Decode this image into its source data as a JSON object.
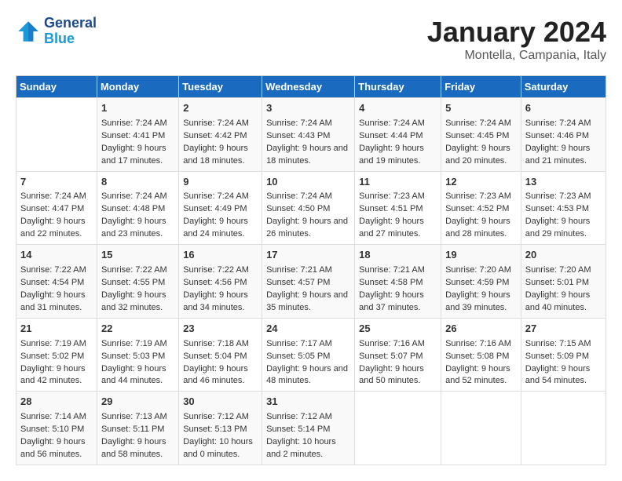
{
  "logo": {
    "line1": "General",
    "line2": "Blue"
  },
  "title": "January 2024",
  "location": "Montella, Campania, Italy",
  "days_of_week": [
    "Sunday",
    "Monday",
    "Tuesday",
    "Wednesday",
    "Thursday",
    "Friday",
    "Saturday"
  ],
  "weeks": [
    [
      {
        "day": "",
        "sunrise": "",
        "sunset": "",
        "daylight": ""
      },
      {
        "day": "1",
        "sunrise": "Sunrise: 7:24 AM",
        "sunset": "Sunset: 4:41 PM",
        "daylight": "Daylight: 9 hours and 17 minutes."
      },
      {
        "day": "2",
        "sunrise": "Sunrise: 7:24 AM",
        "sunset": "Sunset: 4:42 PM",
        "daylight": "Daylight: 9 hours and 18 minutes."
      },
      {
        "day": "3",
        "sunrise": "Sunrise: 7:24 AM",
        "sunset": "Sunset: 4:43 PM",
        "daylight": "Daylight: 9 hours and 18 minutes."
      },
      {
        "day": "4",
        "sunrise": "Sunrise: 7:24 AM",
        "sunset": "Sunset: 4:44 PM",
        "daylight": "Daylight: 9 hours and 19 minutes."
      },
      {
        "day": "5",
        "sunrise": "Sunrise: 7:24 AM",
        "sunset": "Sunset: 4:45 PM",
        "daylight": "Daylight: 9 hours and 20 minutes."
      },
      {
        "day": "6",
        "sunrise": "Sunrise: 7:24 AM",
        "sunset": "Sunset: 4:46 PM",
        "daylight": "Daylight: 9 hours and 21 minutes."
      }
    ],
    [
      {
        "day": "7",
        "sunrise": "Sunrise: 7:24 AM",
        "sunset": "Sunset: 4:47 PM",
        "daylight": "Daylight: 9 hours and 22 minutes."
      },
      {
        "day": "8",
        "sunrise": "Sunrise: 7:24 AM",
        "sunset": "Sunset: 4:48 PM",
        "daylight": "Daylight: 9 hours and 23 minutes."
      },
      {
        "day": "9",
        "sunrise": "Sunrise: 7:24 AM",
        "sunset": "Sunset: 4:49 PM",
        "daylight": "Daylight: 9 hours and 24 minutes."
      },
      {
        "day": "10",
        "sunrise": "Sunrise: 7:24 AM",
        "sunset": "Sunset: 4:50 PM",
        "daylight": "Daylight: 9 hours and 26 minutes."
      },
      {
        "day": "11",
        "sunrise": "Sunrise: 7:23 AM",
        "sunset": "Sunset: 4:51 PM",
        "daylight": "Daylight: 9 hours and 27 minutes."
      },
      {
        "day": "12",
        "sunrise": "Sunrise: 7:23 AM",
        "sunset": "Sunset: 4:52 PM",
        "daylight": "Daylight: 9 hours and 28 minutes."
      },
      {
        "day": "13",
        "sunrise": "Sunrise: 7:23 AM",
        "sunset": "Sunset: 4:53 PM",
        "daylight": "Daylight: 9 hours and 29 minutes."
      }
    ],
    [
      {
        "day": "14",
        "sunrise": "Sunrise: 7:22 AM",
        "sunset": "Sunset: 4:54 PM",
        "daylight": "Daylight: 9 hours and 31 minutes."
      },
      {
        "day": "15",
        "sunrise": "Sunrise: 7:22 AM",
        "sunset": "Sunset: 4:55 PM",
        "daylight": "Daylight: 9 hours and 32 minutes."
      },
      {
        "day": "16",
        "sunrise": "Sunrise: 7:22 AM",
        "sunset": "Sunset: 4:56 PM",
        "daylight": "Daylight: 9 hours and 34 minutes."
      },
      {
        "day": "17",
        "sunrise": "Sunrise: 7:21 AM",
        "sunset": "Sunset: 4:57 PM",
        "daylight": "Daylight: 9 hours and 35 minutes."
      },
      {
        "day": "18",
        "sunrise": "Sunrise: 7:21 AM",
        "sunset": "Sunset: 4:58 PM",
        "daylight": "Daylight: 9 hours and 37 minutes."
      },
      {
        "day": "19",
        "sunrise": "Sunrise: 7:20 AM",
        "sunset": "Sunset: 4:59 PM",
        "daylight": "Daylight: 9 hours and 39 minutes."
      },
      {
        "day": "20",
        "sunrise": "Sunrise: 7:20 AM",
        "sunset": "Sunset: 5:01 PM",
        "daylight": "Daylight: 9 hours and 40 minutes."
      }
    ],
    [
      {
        "day": "21",
        "sunrise": "Sunrise: 7:19 AM",
        "sunset": "Sunset: 5:02 PM",
        "daylight": "Daylight: 9 hours and 42 minutes."
      },
      {
        "day": "22",
        "sunrise": "Sunrise: 7:19 AM",
        "sunset": "Sunset: 5:03 PM",
        "daylight": "Daylight: 9 hours and 44 minutes."
      },
      {
        "day": "23",
        "sunrise": "Sunrise: 7:18 AM",
        "sunset": "Sunset: 5:04 PM",
        "daylight": "Daylight: 9 hours and 46 minutes."
      },
      {
        "day": "24",
        "sunrise": "Sunrise: 7:17 AM",
        "sunset": "Sunset: 5:05 PM",
        "daylight": "Daylight: 9 hours and 48 minutes."
      },
      {
        "day": "25",
        "sunrise": "Sunrise: 7:16 AM",
        "sunset": "Sunset: 5:07 PM",
        "daylight": "Daylight: 9 hours and 50 minutes."
      },
      {
        "day": "26",
        "sunrise": "Sunrise: 7:16 AM",
        "sunset": "Sunset: 5:08 PM",
        "daylight": "Daylight: 9 hours and 52 minutes."
      },
      {
        "day": "27",
        "sunrise": "Sunrise: 7:15 AM",
        "sunset": "Sunset: 5:09 PM",
        "daylight": "Daylight: 9 hours and 54 minutes."
      }
    ],
    [
      {
        "day": "28",
        "sunrise": "Sunrise: 7:14 AM",
        "sunset": "Sunset: 5:10 PM",
        "daylight": "Daylight: 9 hours and 56 minutes."
      },
      {
        "day": "29",
        "sunrise": "Sunrise: 7:13 AM",
        "sunset": "Sunset: 5:11 PM",
        "daylight": "Daylight: 9 hours and 58 minutes."
      },
      {
        "day": "30",
        "sunrise": "Sunrise: 7:12 AM",
        "sunset": "Sunset: 5:13 PM",
        "daylight": "Daylight: 10 hours and 0 minutes."
      },
      {
        "day": "31",
        "sunrise": "Sunrise: 7:12 AM",
        "sunset": "Sunset: 5:14 PM",
        "daylight": "Daylight: 10 hours and 2 minutes."
      },
      {
        "day": "",
        "sunrise": "",
        "sunset": "",
        "daylight": ""
      },
      {
        "day": "",
        "sunrise": "",
        "sunset": "",
        "daylight": ""
      },
      {
        "day": "",
        "sunrise": "",
        "sunset": "",
        "daylight": ""
      }
    ]
  ]
}
